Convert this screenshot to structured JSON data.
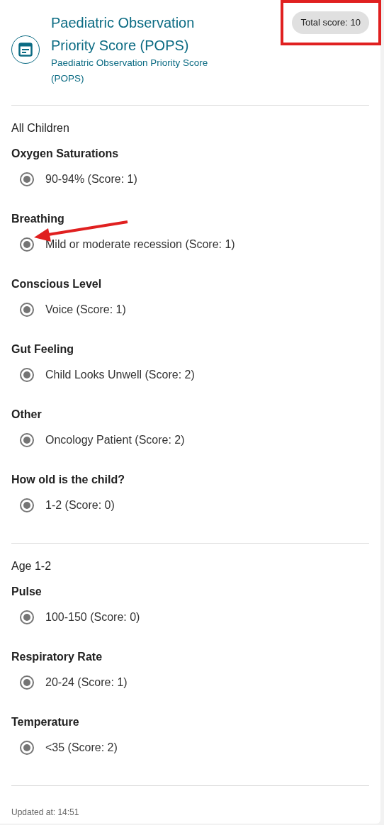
{
  "header": {
    "title": "Paediatric Observation Priority Score (POPS)",
    "subtitle": "Paediatric Observation Priority Score (POPS)",
    "total_score": "Total score: 10"
  },
  "sections": [
    {
      "title": "All Children",
      "questions": [
        {
          "label": "Oxygen Saturations",
          "options": [
            {
              "label": "90-94% (Score: 1)",
              "selected": true
            }
          ]
        },
        {
          "label": "Breathing",
          "options": [
            {
              "label": "Mild or moderate recession (Score: 1)",
              "selected": true
            }
          ]
        },
        {
          "label": "Conscious Level",
          "options": [
            {
              "label": "Voice (Score: 1)",
              "selected": true
            }
          ]
        },
        {
          "label": "Gut Feeling",
          "options": [
            {
              "label": "Child Looks Unwell (Score: 2)",
              "selected": true
            }
          ]
        },
        {
          "label": "Other",
          "options": [
            {
              "label": "Oncology Patient (Score: 2)",
              "selected": true
            }
          ]
        },
        {
          "label": "How old is the child?",
          "options": [
            {
              "label": "1-2 (Score: 0)",
              "selected": true
            }
          ]
        }
      ]
    },
    {
      "title": "Age 1-2",
      "questions": [
        {
          "label": "Pulse",
          "options": [
            {
              "label": "100-150 (Score: 0)",
              "selected": true
            }
          ]
        },
        {
          "label": "Respiratory Rate",
          "options": [
            {
              "label": "20-24 (Score: 1)",
              "selected": true
            }
          ]
        },
        {
          "label": "Temperature",
          "options": [
            {
              "label": "<35 (Score: 2)",
              "selected": true
            }
          ]
        }
      ]
    }
  ],
  "footer": "Updated at: 14:51"
}
